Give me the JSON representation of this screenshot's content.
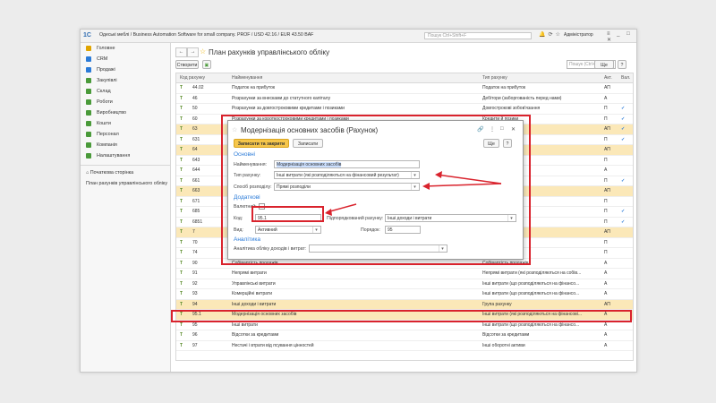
{
  "titlebar": {
    "logo": "1С",
    "title": "Одеські меблі / Business Automation Software for small company. PROF / USD 42.16 / EUR 43.50 BAF",
    "search_placeholder": "Пошук Ctrl+Shift+F",
    "user": "Адміністратор"
  },
  "sidebar": {
    "items": [
      {
        "label": "Головне",
        "color": "#e0a400"
      },
      {
        "label": "CRM",
        "color": "#2b7bd8"
      },
      {
        "label": "Продажі",
        "color": "#2b7bd8"
      },
      {
        "label": "Закупівлі",
        "color": "#4a9a3a"
      },
      {
        "label": "Склад",
        "color": "#4a9a3a"
      },
      {
        "label": "Роботи",
        "color": "#4a9a3a"
      },
      {
        "label": "Виробництво",
        "color": "#4a9a3a"
      },
      {
        "label": "Кошти",
        "color": "#4a9a3a"
      },
      {
        "label": "Персонал",
        "color": "#4a9a3a"
      },
      {
        "label": "Компанія",
        "color": "#4a9a3a"
      },
      {
        "label": "Налаштування",
        "color": "#4a9a3a"
      }
    ],
    "home": "Початкова сторінка",
    "open": "План рахунків управлінського обліку"
  },
  "main": {
    "title": "План рахунків управлінського обліку",
    "create_label": "Створити",
    "search_placeholder": "Пошук (Ctrl+F)",
    "more_label": "Ще"
  },
  "table": {
    "headers": {
      "code": "Код рахунку",
      "name": "Найменування",
      "type": "Тип рахунку",
      "act": "Акт.",
      "val": "Вал."
    },
    "rows": [
      {
        "code": "44.02",
        "name": "Податок на прибуток",
        "type": "Податок на прибуток",
        "act": "АП",
        "chk": ""
      },
      {
        "code": "46",
        "name": "Розрахунки за внесками до статутного капіталу",
        "type": "Дебітори (заборгованість перед нами)",
        "act": "А",
        "chk": ""
      },
      {
        "code": "50",
        "name": "Розрахунки за довгостроковими кредитами і позиками",
        "type": "Довгострокові зобов'язання",
        "act": "П",
        "chk": "✓"
      },
      {
        "code": "60",
        "name": "Розрахунки за короткостроковими кредитами і позиками",
        "type": "Кредити й позики",
        "act": "П",
        "chk": "✓"
      },
      {
        "code": "63",
        "name": "",
        "type": "",
        "act": "АП",
        "chk": "✓",
        "grp": true
      },
      {
        "code": "631",
        "name": "",
        "type": "(заборгованість)",
        "act": "П",
        "chk": "✓"
      },
      {
        "code": "64",
        "name": "",
        "type": "",
        "act": "АП",
        "chk": "",
        "grp": true
      },
      {
        "code": "643",
        "name": "",
        "type": "",
        "act": "П",
        "chk": ""
      },
      {
        "code": "644",
        "name": "",
        "type": "",
        "act": "А",
        "chk": ""
      },
      {
        "code": "661",
        "name": "",
        "type": "(заборгованість)",
        "act": "П",
        "chk": "✓"
      },
      {
        "code": "663",
        "name": "",
        "type": "",
        "act": "АП",
        "chk": "",
        "grp": true
      },
      {
        "code": "671",
        "name": "",
        "type": "",
        "act": "П",
        "chk": ""
      },
      {
        "code": "685",
        "name": "",
        "type": "(заборгованість)",
        "act": "П",
        "chk": "✓"
      },
      {
        "code": "6851",
        "name": "",
        "type": "(заборгованість)",
        "act": "П",
        "chk": "✓"
      },
      {
        "code": "7",
        "name": "",
        "type": "",
        "act": "АП",
        "chk": "",
        "grp": true
      },
      {
        "code": "70",
        "name": "",
        "type": "",
        "act": "П",
        "chk": ""
      },
      {
        "code": "74",
        "name": "",
        "type": "",
        "act": "П",
        "chk": ""
      },
      {
        "code": "90",
        "name": "Собівартість продажів",
        "type": "Собівартість продажів",
        "act": "А",
        "chk": ""
      },
      {
        "code": "91",
        "name": "Непрямі витрати",
        "type": "Непрямі витрати (які розподіляються на собів...",
        "act": "А",
        "chk": ""
      },
      {
        "code": "92",
        "name": "Управлінські витрати",
        "type": "Інші витрати (що розподіляються на фінансо...",
        "act": "А",
        "chk": ""
      },
      {
        "code": "93",
        "name": "Комерційні витрати",
        "type": "Інші витрати (що розподіляються на фінансо...",
        "act": "А",
        "chk": ""
      },
      {
        "code": "94",
        "name": "Інші доходи і витрати",
        "type": "Група рахунку",
        "act": "АП",
        "chk": "",
        "grp": true
      },
      {
        "code": "95.1",
        "name": "Модернізація основних засобів",
        "type": "Інші витрати (які розподіляються на фінансові...",
        "act": "А",
        "chk": "",
        "sel": true
      },
      {
        "code": "95",
        "name": "Інші витрати",
        "type": "Інші витрати (що розподіляються на фінансо...",
        "act": "А",
        "chk": ""
      },
      {
        "code": "96",
        "name": "Відсотки за кредитами",
        "type": "Відсотки за кредитами",
        "act": "А",
        "chk": ""
      },
      {
        "code": "97",
        "name": "Нестачі і втрати від псування цінностей",
        "type": "Інші оборотні активи",
        "act": "А",
        "chk": ""
      }
    ]
  },
  "dialog": {
    "title": "Модернізація основних засобів (Рахунок)",
    "save_close": "Записати та закрити",
    "save": "Записати",
    "more": "Ще",
    "help": "?",
    "sec_main": "Основні",
    "name_label": "Найменування:",
    "name_value": "Модернізація основних засобів",
    "type_label": "Тип рахунку:",
    "type_value": "Інші витрати (які розподіляються на фінансовий результат)",
    "dist_label": "Спосіб розподілу:",
    "dist_value": "Прямі розподіли",
    "sec_extra": "Додаткові",
    "currency_label": "Валютний:",
    "code_label": "Код:",
    "code_value": "95.1",
    "parent_label": "Підпорядкований рахунку:",
    "parent_value": "Інші доходи і витрати",
    "kind_label": "Вид:",
    "kind_value": "Активний",
    "order_label": "Порядок:",
    "order_value": "95",
    "sec_analytics": "Аналітика",
    "analytics_label": "Аналітика обліку доходів і витрат:",
    "analytics_value": ""
  }
}
